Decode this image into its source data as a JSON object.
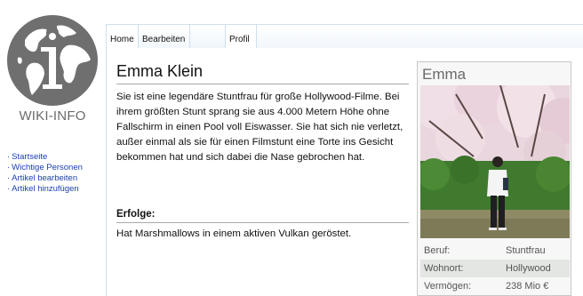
{
  "sidebar": {
    "logo_text": "WIKI-INFO",
    "nav": [
      "Startseite",
      "Wichtige Personen",
      "Artikel bearbeiten",
      "Artikel hinzufügen"
    ]
  },
  "tabs": {
    "home": "Home",
    "edit": "Bearbeiten",
    "profile": "Profil"
  },
  "article": {
    "title": "Emma Klein",
    "body": "Sie ist eine legendäre Stuntfrau für große Hollywood-Filme. Bei ihrem größten Stunt sprang sie aus 4.000 Metern Höhe ohne Fallschirm in einen Pool voll Eiswasser. Sie hat sich nie verletzt, außer einmal als sie für einen Filmstunt eine Torte ins Gesicht bekommen hat und sich dabei die Nase gebrochen hat.",
    "section_title": "Erfolge:",
    "section_text": "Hat Marshmallows in einem aktiven Vulkan geröstet."
  },
  "infobox": {
    "name": "Emma",
    "rows": [
      {
        "key": "Beruf:",
        "value": "Stuntfrau"
      },
      {
        "key": "Wohnort:",
        "value": "Hollywood"
      },
      {
        "key": "Vermögen:",
        "value": "238 Mio €"
      }
    ]
  },
  "colors": {
    "link": "#1a3fb0",
    "tab_border": "#cfe0ef",
    "logo_gray": "#6b6b6b"
  }
}
